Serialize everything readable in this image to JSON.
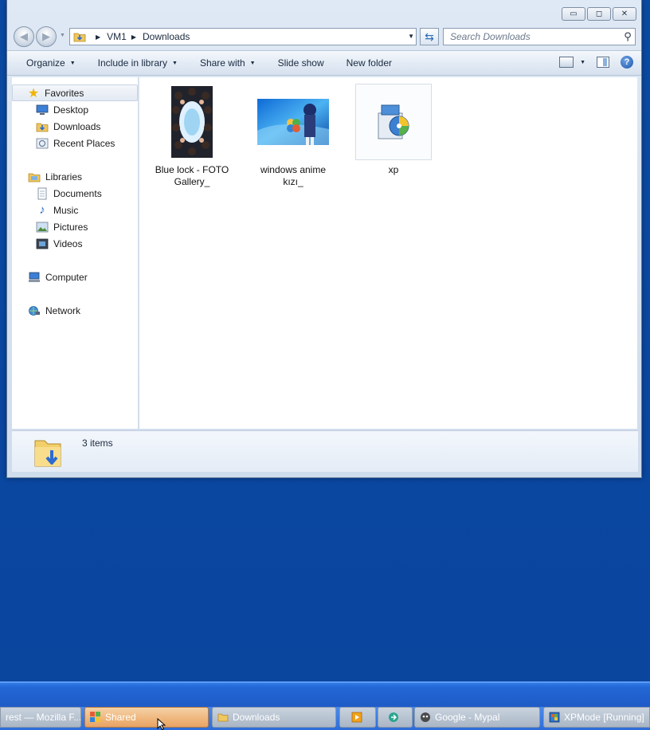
{
  "window": {
    "controls": {
      "minimize": "▭",
      "maximize": "◻",
      "close": "✕"
    }
  },
  "nav": {
    "back_glyph": "◀",
    "forward_glyph": "▶",
    "breadcrumb": [
      "VM1",
      "Downloads"
    ],
    "search_placeholder": "Search Downloads"
  },
  "toolbar": {
    "items": [
      {
        "label": "Organize",
        "dropdown": true
      },
      {
        "label": "Include in library",
        "dropdown": true
      },
      {
        "label": "Share with",
        "dropdown": true
      },
      {
        "label": "Slide show",
        "dropdown": false
      },
      {
        "label": "New folder",
        "dropdown": false
      }
    ]
  },
  "navpane": {
    "favorites": {
      "label": "Favorites",
      "items": [
        "Desktop",
        "Downloads",
        "Recent Places"
      ]
    },
    "libraries": {
      "label": "Libraries",
      "items": [
        "Documents",
        "Music",
        "Pictures",
        "Videos"
      ]
    },
    "computer": "Computer",
    "network": "Network"
  },
  "files": [
    {
      "name_line1": "Blue lock - FOTO",
      "name_line2": "Gallery_",
      "icon": "portrait-image-thumbnail"
    },
    {
      "name_line1": "windows anime",
      "name_line2": "kızı_",
      "icon": "landscape-image-thumbnail"
    },
    {
      "name_line1": "xp",
      "name_line2": "",
      "icon": "installer-icon"
    }
  ],
  "status": {
    "count": "3 items"
  },
  "taskbar": {
    "buttons": [
      "rest — Mozilla F...",
      "Shared",
      "Downloads",
      "Google - Mypal",
      "XPMode [Running]"
    ]
  },
  "colors": {
    "desktop": "#0a4aa1",
    "taskbar": "#1f5cc9",
    "active_taskbar_button": "#efb57a",
    "favorites_star": "#f0b400"
  }
}
